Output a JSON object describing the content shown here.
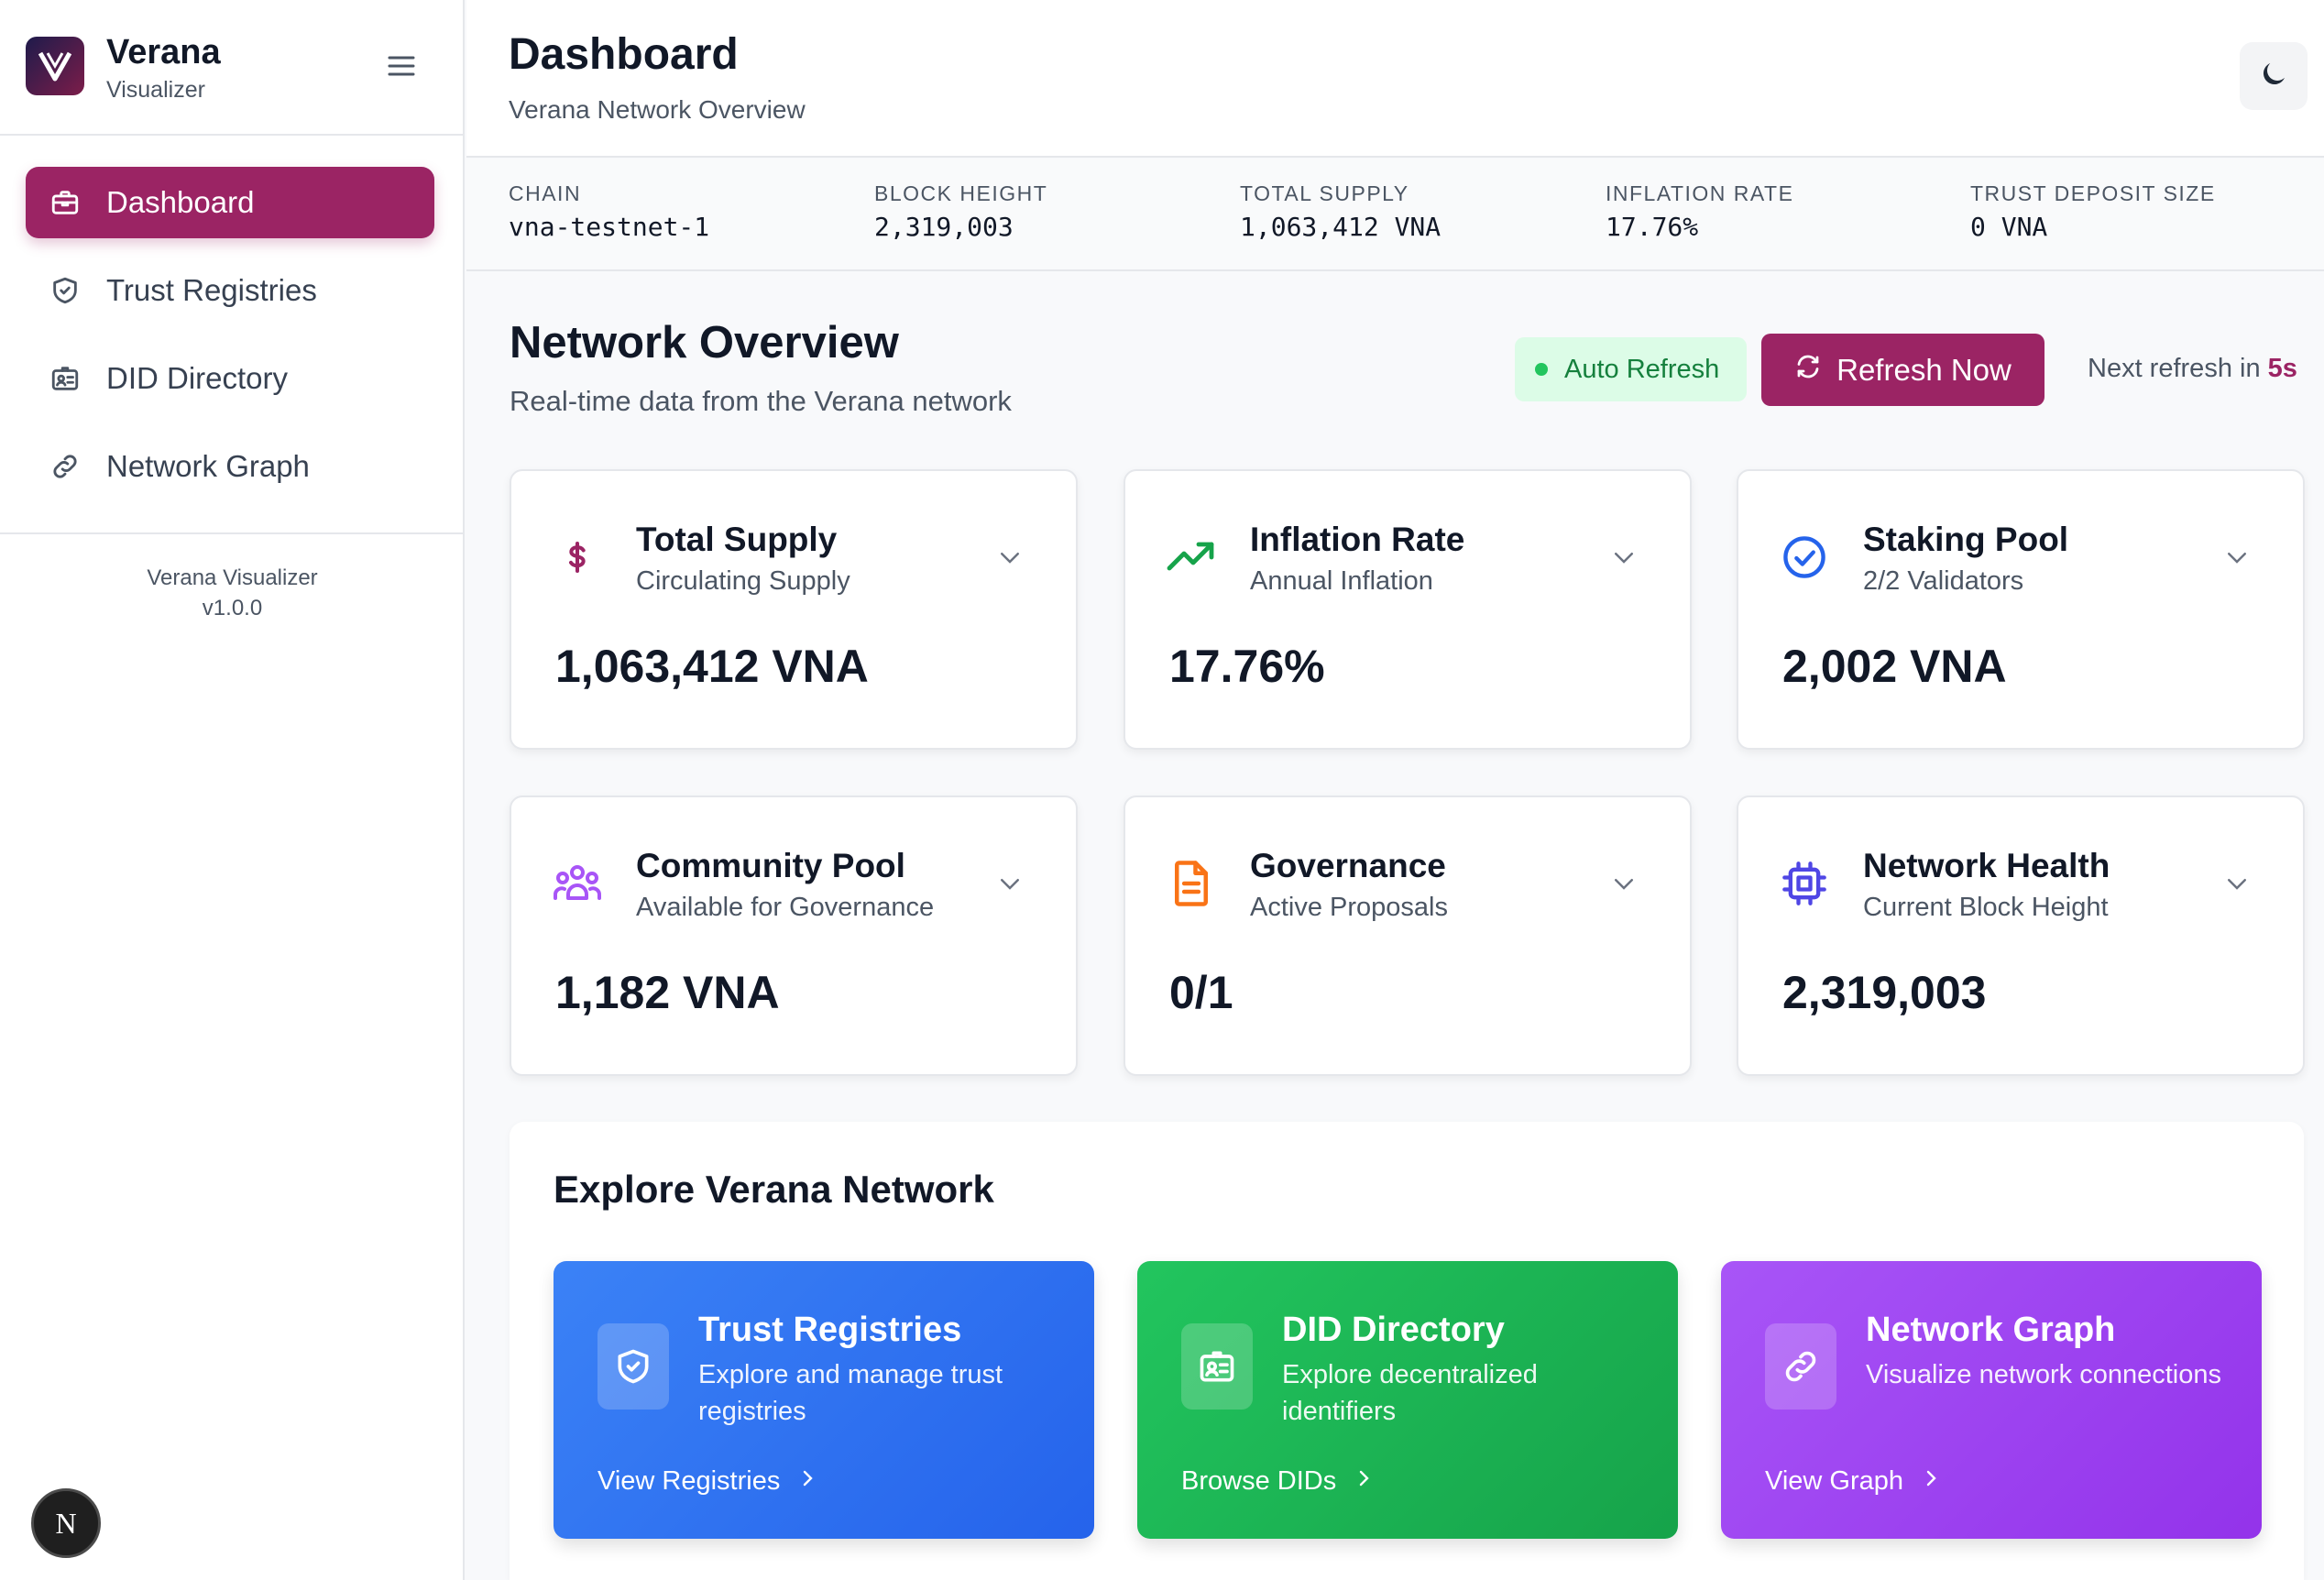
{
  "sidebar": {
    "brand_title": "Verana",
    "brand_subtitle": "Visualizer",
    "items": [
      {
        "label": "Dashboard",
        "icon": "briefcase-icon",
        "active": true
      },
      {
        "label": "Trust Registries",
        "icon": "shield-check-icon",
        "active": false
      },
      {
        "label": "DID Directory",
        "icon": "id-card-icon",
        "active": false
      },
      {
        "label": "Network Graph",
        "icon": "link-icon",
        "active": false
      }
    ],
    "version_name": "Verana Visualizer",
    "version": "v1.0.0",
    "bottom_badge": "N"
  },
  "header": {
    "title": "Dashboard",
    "subtitle": "Verana Network Overview"
  },
  "stats": [
    {
      "label": "CHAIN",
      "value": "vna-testnet-1"
    },
    {
      "label": "BLOCK HEIGHT",
      "value": "2,319,003"
    },
    {
      "label": "TOTAL SUPPLY",
      "value": "1,063,412 VNA"
    },
    {
      "label": "INFLATION RATE",
      "value": "17.76%"
    },
    {
      "label": "TRUST DEPOSIT SIZE",
      "value": "0 VNA"
    }
  ],
  "overview": {
    "title": "Network Overview",
    "subtitle": "Real-time data from the Verana network",
    "auto_refresh_label": "Auto Refresh",
    "refresh_button": "Refresh Now",
    "next_refresh_prefix": "Next refresh in",
    "next_refresh_value": "5s"
  },
  "cards": [
    {
      "title": "Total Supply",
      "subtitle": "Circulating Supply",
      "value": "1,063,412 VNA",
      "icon": "dollar-icon",
      "icon_color": "#9b2464"
    },
    {
      "title": "Inflation Rate",
      "subtitle": "Annual Inflation",
      "value": "17.76%",
      "icon": "trending-up-icon",
      "icon_color": "#16a34a"
    },
    {
      "title": "Staking Pool",
      "subtitle": "2/2 Validators",
      "value": "2,002 VNA",
      "icon": "check-circle-icon",
      "icon_color": "#2563eb"
    },
    {
      "title": "Community Pool",
      "subtitle": "Available for Governance",
      "value": "1,182 VNA",
      "icon": "users-icon",
      "icon_color": "#a855f7"
    },
    {
      "title": "Governance",
      "subtitle": "Active Proposals",
      "value": "0/1",
      "icon": "document-icon",
      "icon_color": "#f97316"
    },
    {
      "title": "Network Health",
      "subtitle": "Current Block Height",
      "value": "2,319,003",
      "icon": "cpu-chip-icon",
      "icon_color": "#4f46e5"
    }
  ],
  "explore": {
    "title": "Explore Verana Network",
    "items": [
      {
        "title": "Trust Registries",
        "description": "Explore and manage trust registries",
        "link": "View Registries",
        "icon": "shield-check-icon"
      },
      {
        "title": "DID Directory",
        "description": "Explore decentralized identifiers",
        "link": "Browse DIDs",
        "icon": "id-card-icon"
      },
      {
        "title": "Network Graph",
        "description": "Visualize network connections",
        "link": "View Graph",
        "icon": "link-icon"
      }
    ]
  },
  "colors": {
    "accent": "#9b2464",
    "auto_refresh_bg": "#dcfce7",
    "auto_refresh_text": "#15803d",
    "explore_blue": "#3b82f6",
    "explore_green": "#22c55e",
    "explore_purple": "#a855f7"
  }
}
